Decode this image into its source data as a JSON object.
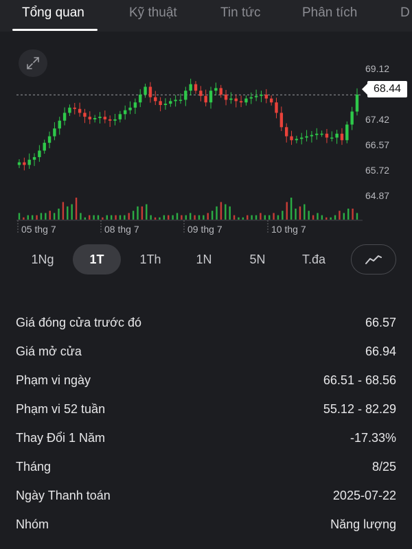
{
  "tabs": [
    "Tổng quan",
    "Kỹ thuật",
    "Tin tức",
    "Phân tích",
    "D"
  ],
  "current_price": "68.44",
  "chart_data": {
    "type": "candlestick",
    "y_ticks": [
      "69.12",
      "67.42",
      "66.57",
      "65.72",
      "64.87"
    ],
    "y_ticks_values": [
      69.12,
      67.42,
      66.57,
      65.72,
      64.87
    ],
    "x_ticks": [
      "05 thg 7",
      "08 thg 7",
      "09 thg 7",
      "10 thg 7"
    ],
    "reference_line": 68.44,
    "ylim": [
      64.6,
      69.5
    ],
    "closes": [
      65.85,
      65.75,
      65.95,
      66.05,
      66.3,
      66.6,
      66.85,
      67.15,
      67.45,
      67.75,
      67.95,
      67.9,
      67.75,
      67.6,
      67.5,
      67.55,
      67.6,
      67.5,
      67.45,
      67.5,
      67.7,
      67.85,
      67.95,
      68.15,
      68.45,
      68.75,
      68.35,
      68.2,
      68.05,
      68.1,
      68.2,
      68.25,
      68.25,
      68.6,
      68.85,
      68.6,
      68.4,
      68.15,
      68.6,
      68.7,
      68.45,
      68.25,
      68.3,
      68.2,
      68.15,
      68.3,
      68.35,
      68.4,
      68.45,
      68.3,
      68.15,
      67.75,
      67.2,
      66.85,
      66.7,
      66.75,
      66.8,
      66.85,
      66.9,
      66.95,
      66.95,
      66.8,
      66.8,
      66.95,
      66.7,
      67.3,
      67.8,
      68.45
    ],
    "volumes": [
      3,
      1,
      2,
      2,
      2,
      3,
      3,
      4,
      3,
      5,
      8,
      6,
      7,
      10,
      3,
      1,
      2,
      2,
      2,
      1,
      2,
      2,
      2,
      2,
      2,
      3,
      4,
      6,
      6,
      7,
      2,
      1,
      1,
      2,
      2,
      2,
      3,
      2,
      2,
      3,
      2,
      2,
      2,
      3,
      4,
      6,
      8,
      7,
      6,
      2,
      1,
      1,
      2,
      2,
      2,
      3,
      2,
      2,
      3,
      2,
      4,
      8,
      10,
      5,
      6,
      7,
      4,
      2,
      3,
      2,
      1,
      1,
      2,
      4,
      3,
      5,
      5,
      3
    ]
  },
  "ranges": [
    "1Ng",
    "1T",
    "1Th",
    "1N",
    "5N",
    "T.đa"
  ],
  "active_range": "1T",
  "stats": [
    {
      "label": "Giá đóng cửa trước đó",
      "value": "66.57"
    },
    {
      "label": "Giá mở cửa",
      "value": "66.94"
    },
    {
      "label": "Phạm vi ngày",
      "value": "66.51 - 68.56"
    },
    {
      "label": "Phạm vi 52 tuần",
      "value": "55.12 - 82.29"
    },
    {
      "label": "Thay Đổi 1 Năm",
      "value": "-17.33%"
    },
    {
      "label": "Tháng",
      "value": "8/25"
    },
    {
      "label": "Ngày Thanh toán",
      "value": "2025-07-22"
    },
    {
      "label": "Nhóm",
      "value": "Năng lượng"
    }
  ],
  "colors": {
    "up": "#2ec84a",
    "down": "#e8423a",
    "bg": "#1c1d21",
    "axis_text": "#b8b9be"
  },
  "icons": {
    "expand": "expand-icon",
    "chart_type": "line-chart-icon"
  }
}
